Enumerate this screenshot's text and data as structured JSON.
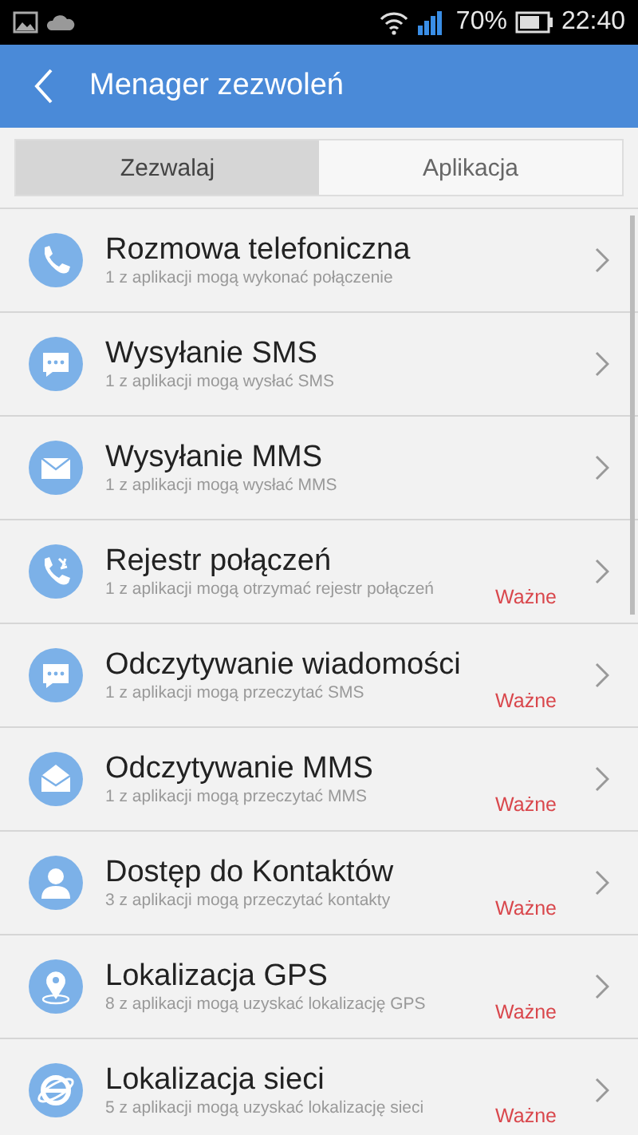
{
  "status_bar": {
    "battery": "70%",
    "time": "22:40"
  },
  "header": {
    "title": "Menager zezwoleń"
  },
  "tabs": [
    {
      "label": "Zezwalaj",
      "selected": true
    },
    {
      "label": "Aplikacja",
      "selected": false
    }
  ],
  "permissions": [
    {
      "kind": "phone",
      "title": "Rozmowa telefoniczna",
      "subtitle": "1 z aplikacji mogą wykonać połączenie"
    },
    {
      "kind": "chat",
      "title": "Wysyłanie SMS",
      "subtitle": "1 z aplikacji mogą wysłać SMS"
    },
    {
      "kind": "envelope",
      "title": "Wysyłanie MMS",
      "subtitle": "1 z aplikacji mogą wysłać MMS"
    },
    {
      "kind": "calllog",
      "title": "Rejestr połączeń",
      "subtitle": "1 z aplikacji mogą otrzymać rejestr połączeń",
      "badge": "Ważne"
    },
    {
      "kind": "chat",
      "title": "Odczytywanie wiadomości",
      "subtitle": "1 z aplikacji mogą przeczytać SMS",
      "badge": "Ważne"
    },
    {
      "kind": "letter",
      "title": "Odczytywanie MMS",
      "subtitle": "1 z aplikacji mogą przeczytać MMS",
      "badge": "Ważne"
    },
    {
      "kind": "contact",
      "title": "Dostęp do Kontaktów",
      "subtitle": "3 z aplikacji mogą przeczytać kontakty",
      "badge": "Ważne"
    },
    {
      "kind": "gps",
      "title": "Lokalizacja GPS",
      "subtitle": "8 z aplikacji mogą uzyskać lokalizację GPS",
      "badge": "Ważne"
    },
    {
      "kind": "network",
      "title": "Lokalizacja sieci",
      "subtitle": "5 z aplikacji mogą uzyskać lokalizację sieci",
      "badge": "Ważne"
    }
  ]
}
